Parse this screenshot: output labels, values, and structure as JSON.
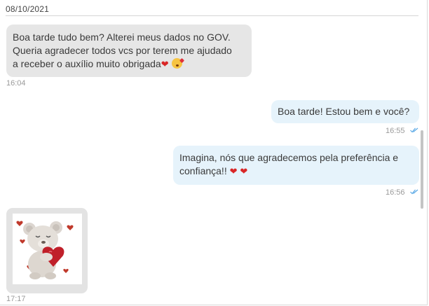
{
  "chat": {
    "date_label": "08/10/2021",
    "messages": [
      {
        "direction": "incoming",
        "lines": [
          "Boa tarde tudo bem? Alterei meus dados no GOV.",
          "Queria agradecer todos vcs por terem me ajudado",
          "a receber o auxílio muito obrigada"
        ],
        "emoji": [
          "heart",
          "kiss-face"
        ],
        "time": "16:04"
      },
      {
        "direction": "outgoing",
        "text": "Boa tarde! Estou bem e você?",
        "time": "16:55",
        "status": "read"
      },
      {
        "direction": "outgoing",
        "lines": [
          "Imagina, nós que agradecemos pela preferência e",
          "confiança!!"
        ],
        "emoji": [
          "heart",
          "heart"
        ],
        "time": "16:56",
        "status": "read"
      },
      {
        "direction": "incoming",
        "type": "sticker",
        "sticker": "teddy-bear-with-heart",
        "time": "17:17"
      }
    ]
  },
  "colors": {
    "incoming_bubble": "#e6e6e6",
    "outgoing_bubble": "#e6f3fb",
    "heart": "#d92626",
    "read_ticks": "#5aa9e6"
  }
}
